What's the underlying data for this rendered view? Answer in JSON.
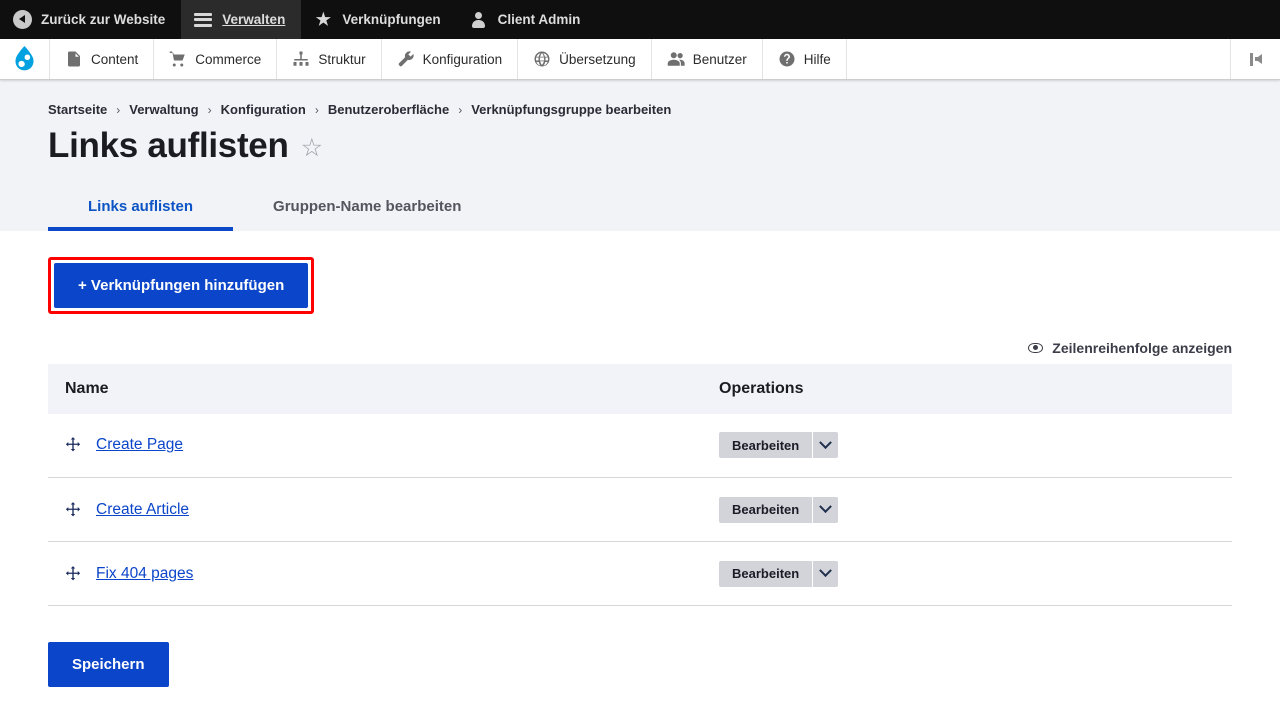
{
  "admin_bar": {
    "items": [
      {
        "label": "Zurück zur Website",
        "icon": "back-circle-icon",
        "active": false
      },
      {
        "label": "Verwalten",
        "icon": "hamburger-icon",
        "active": true
      },
      {
        "label": "Verknüpfungen",
        "icon": "star-icon",
        "active": false
      },
      {
        "label": "Client Admin",
        "icon": "person-icon",
        "active": false
      }
    ]
  },
  "sub_bar": {
    "logo": "drupal-logo",
    "items": [
      {
        "label": "Content",
        "icon": "document-icon"
      },
      {
        "label": "Commerce",
        "icon": "cart-icon"
      },
      {
        "label": "Struktur",
        "icon": "structure-icon"
      },
      {
        "label": "Konfiguration",
        "icon": "wrench-icon"
      },
      {
        "label": "Übersetzung",
        "icon": "globe-icon"
      },
      {
        "label": "Benutzer",
        "icon": "users-icon"
      },
      {
        "label": "Hilfe",
        "icon": "help-icon"
      }
    ],
    "collapse": "collapse-toolbar-icon"
  },
  "breadcrumb": [
    "Startseite",
    "Verwaltung",
    "Konfiguration",
    "Benutzeroberfläche",
    "Verknüpfungsgruppe bearbeiten"
  ],
  "breadcrumb_separator": "›",
  "page": {
    "title": "Links auflisten",
    "bookmark_icon": "☆"
  },
  "tabs": [
    {
      "label": "Links auflisten",
      "active": true
    },
    {
      "label": "Gruppen-Name bearbeiten",
      "active": false
    }
  ],
  "actions": {
    "add_links_label": "+ Verknüpfungen hinzufügen",
    "add_links_highlighted": true,
    "highlight_color": "#fe0000",
    "primary_color": "#0b45c9"
  },
  "order_toggle": {
    "label": "Zeilenreihenfolge anzeigen",
    "icon": "eye-icon"
  },
  "table": {
    "columns": [
      "Name",
      "Operations"
    ],
    "rows": [
      {
        "name": "Create Page",
        "drag_icon": "move-cross-icon",
        "operation": "Bearbeiten",
        "toggle_icon": "chevron-down-icon"
      },
      {
        "name": "Create Article",
        "drag_icon": "move-cross-icon",
        "operation": "Bearbeiten",
        "toggle_icon": "chevron-down-icon"
      },
      {
        "name": "Fix 404 pages",
        "drag_icon": "move-cross-icon",
        "operation": "Bearbeiten",
        "toggle_icon": "chevron-down-icon"
      }
    ]
  },
  "footer": {
    "save_label": "Speichern"
  }
}
